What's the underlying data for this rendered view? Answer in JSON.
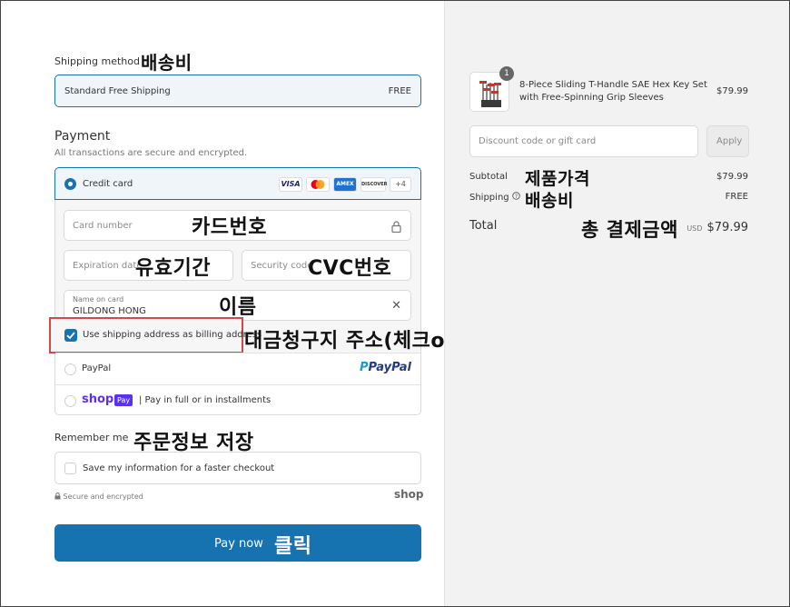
{
  "shipping": {
    "label": "Shipping method",
    "annotation": "배송비",
    "option": "Standard Free Shipping",
    "price": "FREE"
  },
  "payment": {
    "title": "Payment",
    "subtitle": "All transactions are secure and encrypted.",
    "credit_card_label": "Credit card",
    "card_brands": [
      "VISA",
      "MC",
      "AMEX",
      "DISCOVER",
      "+4"
    ],
    "card_number_placeholder": "Card number",
    "card_number_annotation": "카드번호",
    "expiration_placeholder": "Expiration date",
    "expiration_annotation": "유효기간",
    "security_placeholder": "Security code",
    "security_annotation": "CVC번호",
    "name_label": "Name on card",
    "name_value": "GILDONG HONG",
    "name_annotation": "이름",
    "billing_checkbox_label": "Use shipping address as billing address",
    "billing_checked": true,
    "billing_annotation": "대금청구지 주소(체크o)",
    "paypal_label": "PayPal",
    "paypal_logo": "PayPal",
    "shoppay_logo": "shop",
    "shoppay_badge": "Pay",
    "shoppay_label": "| Pay in full or in installments"
  },
  "remember": {
    "label": "Remember me",
    "annotation": "주문정보 저장",
    "checkbox_label": "Save my information for a faster checkout"
  },
  "footer": {
    "secure_text": "Secure and encrypted",
    "shop_logo": "shop"
  },
  "pay_button": {
    "label": "Pay now",
    "annotation": "클릭",
    "color": "#1773b0"
  },
  "summary": {
    "item": {
      "quantity": "1",
      "name": "8-Piece Sliding T-Handle SAE Hex Key Set with Free-Spinning Grip Sleeves",
      "price": "$79.99"
    },
    "discount_placeholder": "Discount code or gift card",
    "apply_label": "Apply",
    "subtotal_label": "Subtotal",
    "subtotal_annotation": "제품가격",
    "subtotal_value": "$79.99",
    "shipping_label": "Shipping",
    "shipping_annotation": "배송비",
    "shipping_value": "FREE",
    "total_label": "Total",
    "total_annotation": "총 결제금액",
    "total_currency": "USD",
    "total_value": "$79.99"
  },
  "colors": {
    "accent": "#1773b0",
    "selected_bg": "#f0f5fa",
    "highlight_border": "#d04a4a"
  }
}
